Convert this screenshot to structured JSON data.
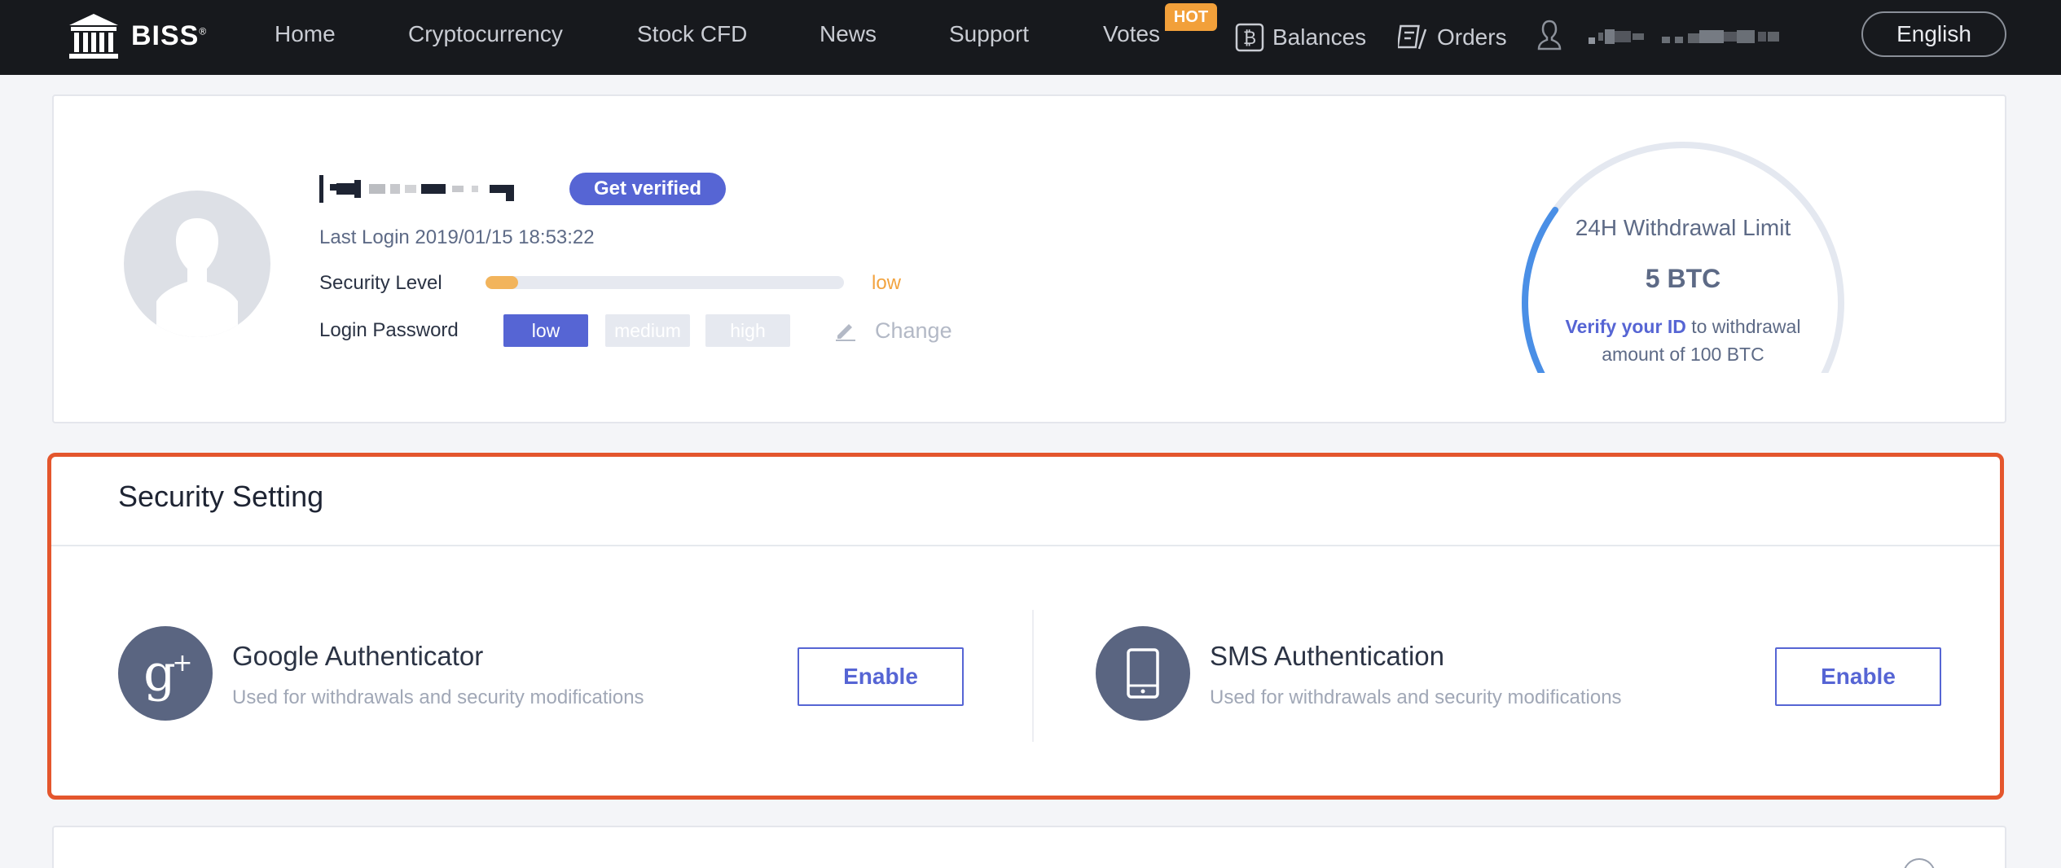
{
  "nav": {
    "brand": "BISS",
    "brand_mark": "®",
    "links": [
      "Home",
      "Cryptocurrency",
      "Stock CFD",
      "News",
      "Support",
      "Votes"
    ],
    "hot_badge": "HOT",
    "balances": "Balances",
    "orders": "Orders",
    "language": "English"
  },
  "profile": {
    "verify_button": "Get verified",
    "last_login": "Last Login 2019/01/15 18:53:22",
    "security_level_label": "Security Level",
    "security_level_value": "low",
    "security_level_fraction": 0.09,
    "login_password_label": "Login Password",
    "password_strength": [
      "low",
      "medium",
      "high"
    ],
    "password_strength_current": "low",
    "change_link": "Change"
  },
  "withdrawal_limit": {
    "title": "24H Withdrawal Limit",
    "value": "5 BTC",
    "verify_link": "Verify your ID",
    "note_rest": " to withdrawal amount of 100 BTC",
    "gauge_fraction": 0.05
  },
  "security": {
    "title": "Security Setting",
    "items": [
      {
        "title": "Google Authenticator",
        "subtitle": "Used for withdrawals and security modifications",
        "button": "Enable",
        "icon": "google-plus-icon"
      },
      {
        "title": "SMS Authentication",
        "subtitle": "Used for withdrawals and security modifications",
        "button": "Enable",
        "icon": "phone-icon"
      }
    ]
  },
  "colors": {
    "accent": "#5665d4",
    "warning": "#f2a33f",
    "highlight_border": "#e4562d",
    "nav_bg": "#17191d"
  }
}
